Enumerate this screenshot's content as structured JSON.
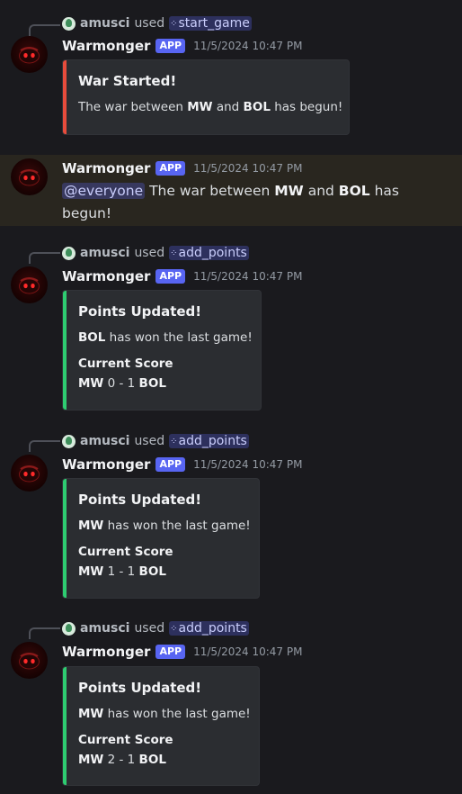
{
  "author": {
    "name": "Warmonger",
    "tag": "APP",
    "timestamp": "11/5/2024 10:47 PM"
  },
  "invoker": {
    "name": "amusci",
    "used_text": "used"
  },
  "colors": {
    "red_bar": "#e74c3c",
    "green_bar": "#2ecc71",
    "app_tag": "#5865f2",
    "mention_bg": "#29261f"
  },
  "messages": [
    {
      "command": "start_game",
      "embed": {
        "title": "War Started!",
        "desc_prefix": "The war between ",
        "team_a": "MW",
        "desc_mid": " and ",
        "team_b": "BOL",
        "desc_suffix": " has begun!"
      }
    },
    {
      "mention": "@everyone",
      "text_prefix": " The war between ",
      "team_a": "MW",
      "text_mid": " and ",
      "team_b": "BOL",
      "text_suffix": " has begun!"
    },
    {
      "command": "add_points",
      "embed": {
        "title": "Points Updated!",
        "winner": "BOL",
        "winner_text": " has won the last game!",
        "field_name": "Current Score",
        "score_a_team": "MW",
        "score_text": " 0 - 1 ",
        "score_b_team": "BOL"
      }
    },
    {
      "command": "add_points",
      "embed": {
        "title": "Points Updated!",
        "winner": "MW",
        "winner_text": " has won the last game!",
        "field_name": "Current Score",
        "score_a_team": "MW",
        "score_text": " 1 - 1 ",
        "score_b_team": "BOL"
      }
    },
    {
      "command": "add_points",
      "embed": {
        "title": "Points Updated!",
        "winner": "MW",
        "winner_text": " has won the last game!",
        "field_name": "Current Score",
        "score_a_team": "MW",
        "score_text": " 2 - 1 ",
        "score_b_team": "BOL"
      }
    }
  ]
}
